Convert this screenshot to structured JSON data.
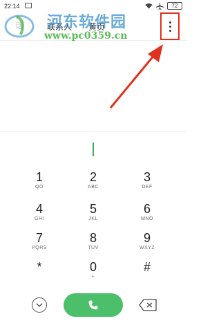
{
  "status_bar": {
    "time": "22:14",
    "battery": "72",
    "icons": [
      "image-icon",
      "wifi-icon",
      "airplane-icon",
      "battery-icon"
    ]
  },
  "tabs": {
    "dialer": "话",
    "contacts": "联系人",
    "yellow_pages": "黄页"
  },
  "more_menu": {
    "icon": "more-vertical-icon"
  },
  "watermark": {
    "title": "河东软件园",
    "url": "www.pc0359.cn"
  },
  "keypad": [
    {
      "digit": "1",
      "letters": "QO"
    },
    {
      "digit": "2",
      "letters": "ABC"
    },
    {
      "digit": "3",
      "letters": "DEF"
    },
    {
      "digit": "4",
      "letters": "GHI"
    },
    {
      "digit": "5",
      "letters": "JKL"
    },
    {
      "digit": "6",
      "letters": "MNO"
    },
    {
      "digit": "7",
      "letters": "PQRS"
    },
    {
      "digit": "8",
      "letters": "TUV"
    },
    {
      "digit": "9",
      "letters": "WXYZ"
    },
    {
      "digit": "*",
      "letters": ""
    },
    {
      "digit": "0",
      "letters": "+"
    },
    {
      "digit": "#",
      "letters": ""
    }
  ],
  "colors": {
    "call_button": "#4cbf6a",
    "highlight": "#e0301e",
    "cursor": "#3fae5a"
  }
}
